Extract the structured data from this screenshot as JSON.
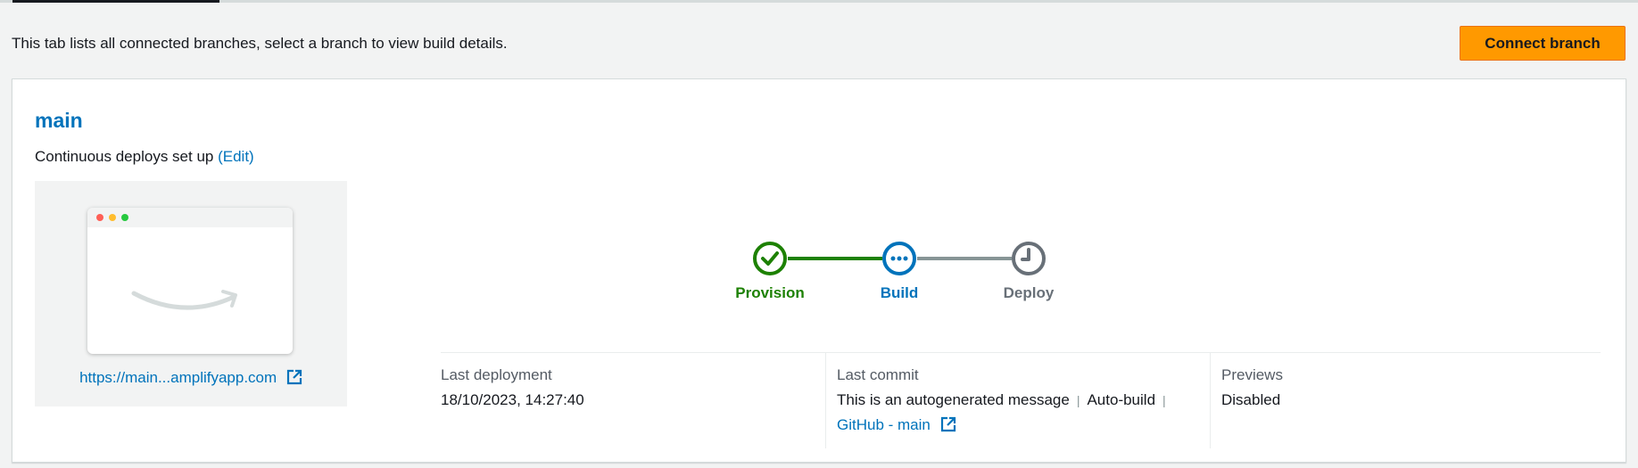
{
  "page": {
    "description": "This tab lists all connected branches, select a branch to view build details.",
    "connect_branch_label": "Connect branch"
  },
  "branch": {
    "name": "main",
    "continuous_deploys_text": "Continuous deploys set up",
    "edit_label": "(Edit)",
    "preview_url": "https://main...amplifyapp.com"
  },
  "pipeline": {
    "steps": [
      {
        "label": "Provision",
        "status": "success",
        "color": "#1d8102",
        "icon": "check-circle-icon"
      },
      {
        "label": "Build",
        "status": "in-progress",
        "color": "#0073bb",
        "icon": "ellipsis-circle-icon"
      },
      {
        "label": "Deploy",
        "status": "pending",
        "color": "#687078",
        "icon": "clock-circle-icon"
      }
    ],
    "connector_colors": [
      "#1d8102",
      "#879596"
    ]
  },
  "details": {
    "last_deployment_label": "Last deployment",
    "last_deployment_value": "18/10/2023, 14:27:40",
    "last_commit_label": "Last commit",
    "last_commit_message": "This is an autogenerated message",
    "last_commit_trigger": "Auto-build",
    "last_commit_repo": "GitHub - main",
    "previews_label": "Previews",
    "previews_value": "Disabled"
  }
}
